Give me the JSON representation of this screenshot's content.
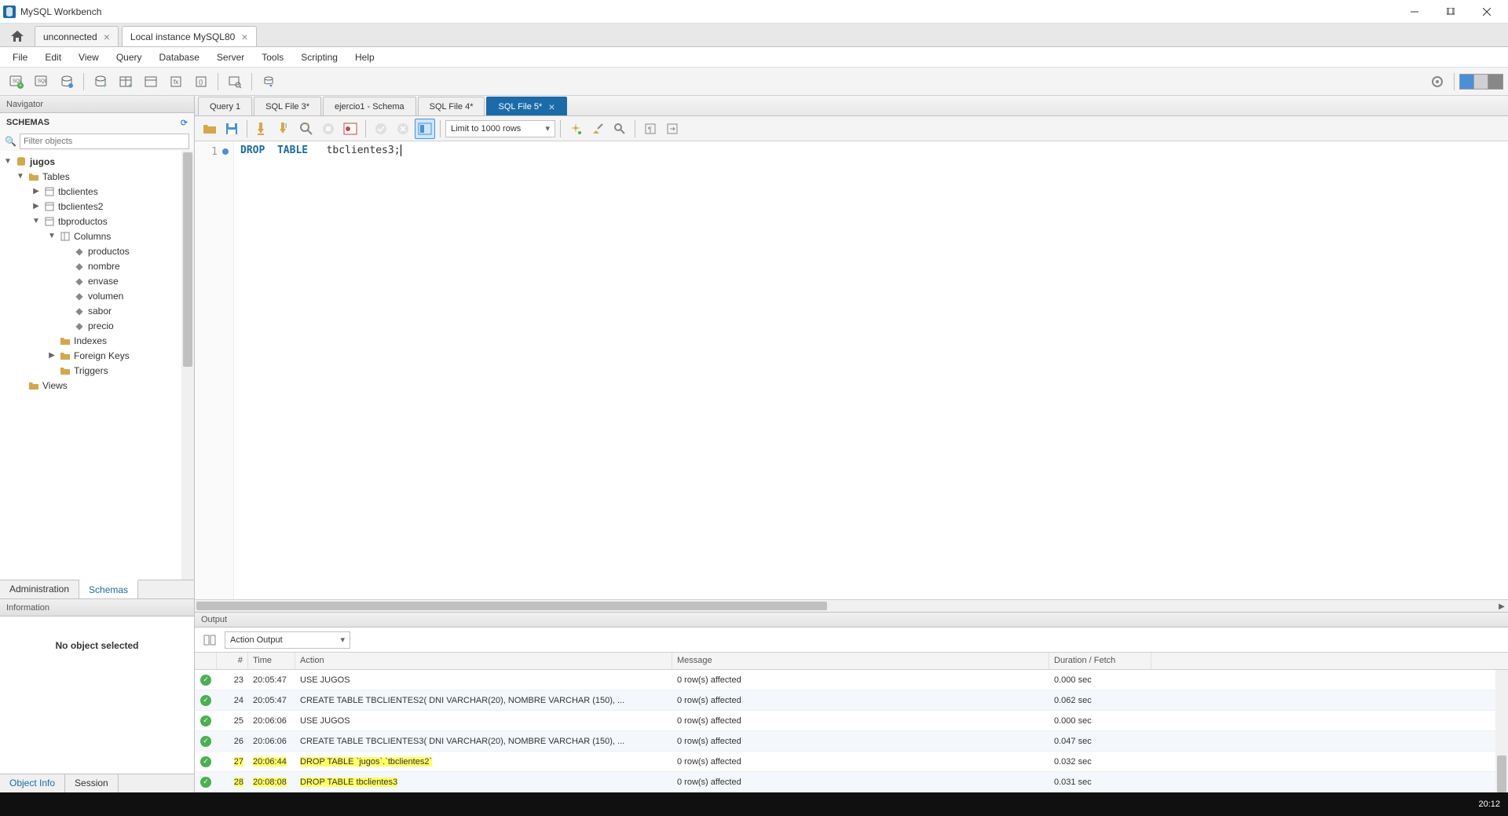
{
  "app": {
    "title": "MySQL Workbench"
  },
  "conn_tabs": [
    {
      "label": "unconnected",
      "active": false
    },
    {
      "label": "Local instance MySQL80",
      "active": true
    }
  ],
  "menu": [
    "File",
    "Edit",
    "View",
    "Query",
    "Database",
    "Server",
    "Tools",
    "Scripting",
    "Help"
  ],
  "navigator": {
    "title": "Navigator",
    "schemas_label": "SCHEMAS",
    "filter_placeholder": "Filter objects",
    "tabs": {
      "admin": "Administration",
      "schemas": "Schemas"
    }
  },
  "tree": {
    "db": "jugos",
    "tables_label": "Tables",
    "tables": [
      "tbclientes",
      "tbclientes2",
      "tbproductos"
    ],
    "columns_label": "Columns",
    "columns": [
      "productos",
      "nombre",
      "envase",
      "volumen",
      "sabor",
      "precio"
    ],
    "indexes": "Indexes",
    "fks": "Foreign Keys",
    "triggers": "Triggers",
    "views": "Views"
  },
  "info": {
    "title": "Information",
    "no_object": "No object selected",
    "tabs": {
      "obj": "Object Info",
      "session": "Session"
    }
  },
  "sql_tabs": [
    {
      "label": "Query 1"
    },
    {
      "label": "SQL File 3*"
    },
    {
      "label": "ejercio1 - Schema"
    },
    {
      "label": "SQL File 4*"
    },
    {
      "label": "SQL File 5*",
      "active": true
    }
  ],
  "sql_toolbar": {
    "limit": "Limit to 1000 rows"
  },
  "code": {
    "line_no": "1",
    "kw1": "DROP",
    "kw2": "TABLE",
    "ident": "tbclientes3",
    "semi": ";"
  },
  "output": {
    "title": "Output",
    "select": "Action Output",
    "headers": {
      "num": "#",
      "time": "Time",
      "action": "Action",
      "message": "Message",
      "duration": "Duration / Fetch"
    },
    "rows": [
      {
        "num": "23",
        "time": "20:05:47",
        "action": "USE JUGOS",
        "msg": "0 row(s) affected",
        "dur": "0.000 sec",
        "hl": false
      },
      {
        "num": "24",
        "time": "20:05:47",
        "action": "CREATE TABLE TBCLIENTES2( DNI VARCHAR(20), NOMBRE VARCHAR (150), ...",
        "msg": "0 row(s) affected",
        "dur": "0.062 sec",
        "hl": false
      },
      {
        "num": "25",
        "time": "20:06:06",
        "action": "USE JUGOS",
        "msg": "0 row(s) affected",
        "dur": "0.000 sec",
        "hl": false
      },
      {
        "num": "26",
        "time": "20:06:06",
        "action": "CREATE TABLE TBCLIENTES3( DNI VARCHAR(20), NOMBRE VARCHAR (150), ...",
        "msg": "0 row(s) affected",
        "dur": "0.047 sec",
        "hl": false
      },
      {
        "num": "27",
        "time": "20:06:44",
        "action": "DROP TABLE `jugos`.`tbclientes2`",
        "msg": "0 row(s) affected",
        "dur": "0.032 sec",
        "hl": true
      },
      {
        "num": "28",
        "time": "20:08:08",
        "action": "DROP TABLE  tbclientes3",
        "msg": "0 row(s) affected",
        "dur": "0.031 sec",
        "hl": true
      }
    ]
  },
  "taskbar": {
    "time": "20:12"
  }
}
